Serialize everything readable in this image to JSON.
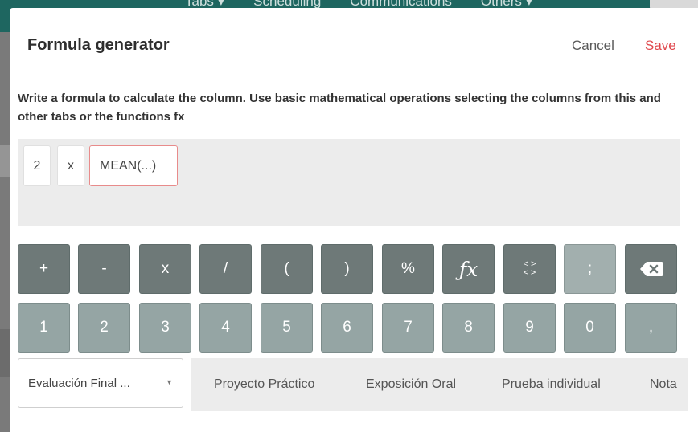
{
  "background": {
    "nav": [
      "Tabs ▾",
      "Scheduling",
      "Communications",
      "Others ▾"
    ]
  },
  "header": {
    "title": "Formula generator",
    "cancel_label": "Cancel",
    "save_label": "Save"
  },
  "instructions": "Write a formula to calculate the column. Use basic mathematical operations selecting the columns from this and other tabs or the functions fx",
  "formula_tokens": [
    "2",
    "x",
    "MEAN(...)"
  ],
  "keypad": {
    "row1": [
      "+",
      "-",
      "x",
      "/",
      "(",
      ")",
      "%",
      "fx",
      "< >\n≤ ≥",
      ";",
      "backspace"
    ],
    "row2": [
      "1",
      "2",
      "3",
      "4",
      "5",
      "6",
      "7",
      "8",
      "9",
      "0",
      ","
    ]
  },
  "column_select": {
    "value": "Evaluación Final ..."
  },
  "column_tabs": [
    "Proyecto Práctico",
    "Exposición Oral",
    "Prueba individual",
    "Nota"
  ],
  "colors": {
    "accent_save": "#e0474c",
    "operator_key": "#6e7978",
    "number_key": "#95a5a4",
    "selected_token_border": "#e88b8b"
  }
}
